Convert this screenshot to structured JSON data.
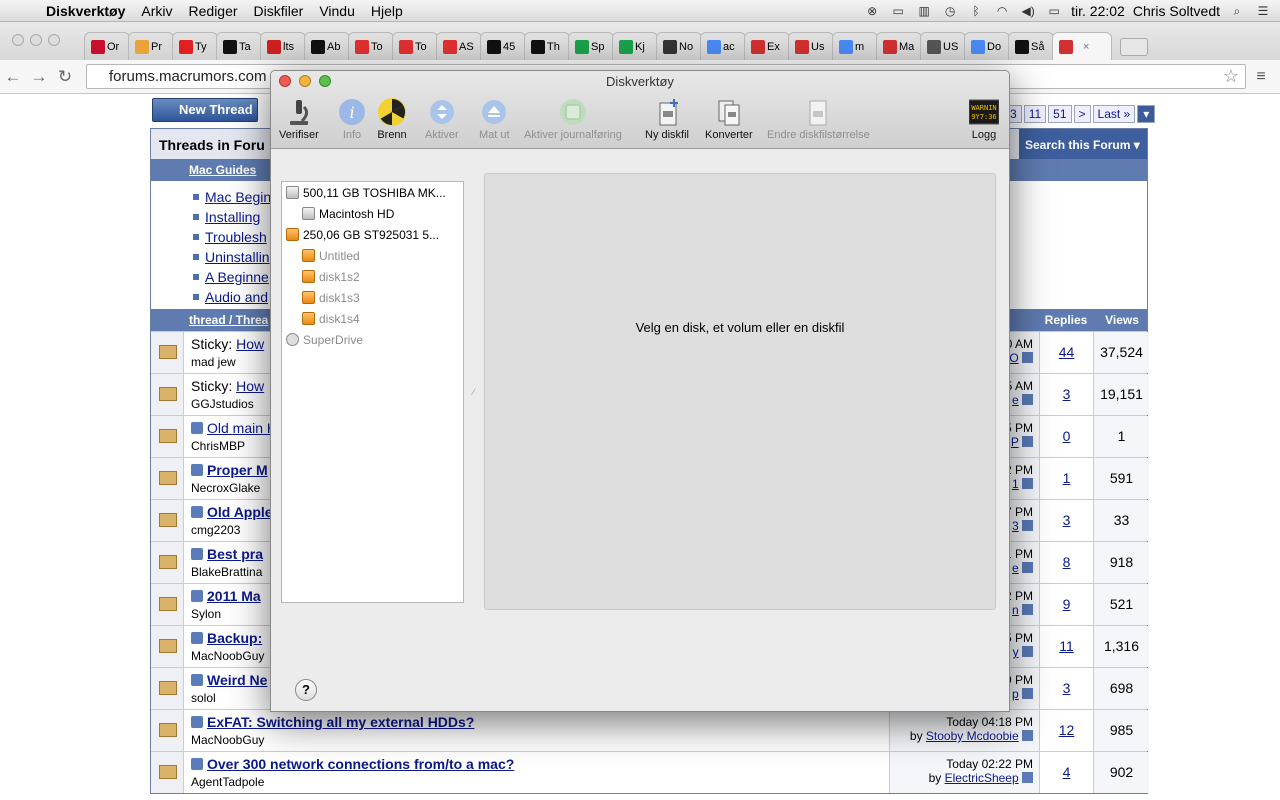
{
  "menubar": {
    "app_name": "Diskverktøy",
    "items": [
      "Arkiv",
      "Rediger",
      "Diskfiler",
      "Vindu",
      "Hjelp"
    ],
    "clock": "tir. 22:02",
    "user": "Chris Soltvedt"
  },
  "browser": {
    "tabs": [
      {
        "label": "Or",
        "color": "#c8102e"
      },
      {
        "label": "Pr",
        "color": "#e8a33a"
      },
      {
        "label": "Ty",
        "color": "#e02020"
      },
      {
        "label": "Ta",
        "color": "#111111"
      },
      {
        "label": "lts",
        "color": "#d02020"
      },
      {
        "label": "Ab",
        "color": "#111111"
      },
      {
        "label": "To",
        "color": "#e03030"
      },
      {
        "label": "To",
        "color": "#e03030"
      },
      {
        "label": "AS",
        "color": "#e03030"
      },
      {
        "label": "45",
        "color": "#111111"
      },
      {
        "label": "Th",
        "color": "#111111"
      },
      {
        "label": "Sp",
        "color": "#1aa04a"
      },
      {
        "label": "Kj",
        "color": "#1aa04a"
      },
      {
        "label": "No",
        "color": "#333333"
      },
      {
        "label": "ac",
        "color": "#4a8af4"
      },
      {
        "label": "Ex",
        "color": "#d03030"
      },
      {
        "label": "Us",
        "color": "#d03030"
      },
      {
        "label": "m",
        "color": "#4a8af4"
      },
      {
        "label": "Ma",
        "color": "#d03030"
      },
      {
        "label": "US",
        "color": "#555555"
      },
      {
        "label": "Do",
        "color": "#4a8af4"
      },
      {
        "label": "Så",
        "color": "#111111"
      },
      {
        "label": "",
        "color": "#d03030"
      }
    ],
    "url": "forums.macrumors.com"
  },
  "forum": {
    "new_thread": "New Thread",
    "pager": [
      "3",
      "11",
      "51",
      ">",
      "Last »"
    ],
    "threads_in_forum": "Threads in Foru",
    "search_forum": "Search this Forum",
    "mac_guides": "Mac Guides",
    "guide_links": [
      "Mac Begin",
      "Installing",
      "Troublesh",
      "Uninstallin",
      "A Beginne",
      "Audio and"
    ],
    "col_thread": "thread / Threa",
    "col_replies": "Replies",
    "col_views": "Views",
    "rows": [
      {
        "prefix": "Sticky:",
        "title": "How",
        "bold": false,
        "user": "mad jew",
        "last_time": "0 AM",
        "last_by": "O",
        "replies": "44",
        "views": "37,524"
      },
      {
        "prefix": "Sticky:",
        "title": "How",
        "bold": false,
        "user": "GGJstudios",
        "last_time": "5 AM",
        "last_by": "e",
        "replies": "3",
        "views": "19,151"
      },
      {
        "prefix": "",
        "title": "Old main HD",
        "bold": false,
        "user": "ChrisMBP",
        "last_time": "5 PM",
        "last_by": "P",
        "replies": "0",
        "views": "1"
      },
      {
        "prefix": "",
        "title": "Proper M",
        "bold": true,
        "user": "NecroxGlake",
        "last_time": "2 PM",
        "last_by": "1",
        "replies": "1",
        "views": "591"
      },
      {
        "prefix": "",
        "title": "Old Apple",
        "bold": true,
        "user": "cmg2203",
        "last_time": "7 PM",
        "last_by": "3",
        "replies": "3",
        "views": "33"
      },
      {
        "prefix": "",
        "title": "Best pra",
        "bold": true,
        "user": "BlakeBrattina",
        "last_time": "1 PM",
        "last_by": "e",
        "replies": "8",
        "views": "918"
      },
      {
        "prefix": "",
        "title": "2011 Ma",
        "bold": true,
        "user": "Sylon",
        "last_time": "2 PM",
        "last_by": "n",
        "replies": "9",
        "views": "521"
      },
      {
        "prefix": "",
        "title": "Backup:",
        "bold": true,
        "user": "MacNoobGuy",
        "last_time": "5 PM",
        "last_by": "y",
        "replies": "11",
        "views": "1,316"
      },
      {
        "prefix": "",
        "title": "Weird Ne",
        "bold": true,
        "user": "solol",
        "last_time": "9 PM",
        "last_by": "p",
        "replies": "3",
        "views": "698"
      },
      {
        "prefix": "",
        "title": "ExFAT: Switching all my external HDDs?",
        "bold": true,
        "user": "MacNoobGuy",
        "last_time": "Today 04:18 PM",
        "last_by": "Stooby Mcdoobie",
        "replies": "12",
        "views": "985"
      },
      {
        "prefix": "",
        "title": "Over 300 network connections from/to a mac?",
        "bold": true,
        "user": "AgentTadpole",
        "last_time": "Today 02:22 PM",
        "last_by": "ElectricSheep",
        "replies": "4",
        "views": "902"
      }
    ]
  },
  "diskutility": {
    "title": "Diskverktøy",
    "toolbar": {
      "verify": "Verifiser",
      "info": "Info",
      "burn": "Brenn",
      "enable": "Aktiver",
      "eject": "Mat ut",
      "journal": "Aktiver journalføring",
      "new_image": "Ny diskfil",
      "convert": "Konverter",
      "resize": "Endre diskfilstørrelse",
      "log": "Logg"
    },
    "log_icon_text": "WARNIN\n9Y7:36",
    "disks": [
      {
        "label": "500,11 GB TOSHIBA MK...",
        "level": 0,
        "type": "hd",
        "dim": false
      },
      {
        "label": "Macintosh HD",
        "level": 1,
        "type": "hd",
        "dim": false
      },
      {
        "label": "250,06 GB ST925031 5...",
        "level": 0,
        "type": "ext",
        "dim": false
      },
      {
        "label": "Untitled",
        "level": 1,
        "type": "ext",
        "dim": true
      },
      {
        "label": "disk1s2",
        "level": 1,
        "type": "ext",
        "dim": true
      },
      {
        "label": "disk1s3",
        "level": 1,
        "type": "ext",
        "dim": true
      },
      {
        "label": "disk1s4",
        "level": 1,
        "type": "ext",
        "dim": true
      },
      {
        "label": "SuperDrive",
        "level": 0,
        "type": "cd",
        "dim": true
      }
    ],
    "message": "Velg en disk, et volum eller en diskfil",
    "help": "?"
  }
}
